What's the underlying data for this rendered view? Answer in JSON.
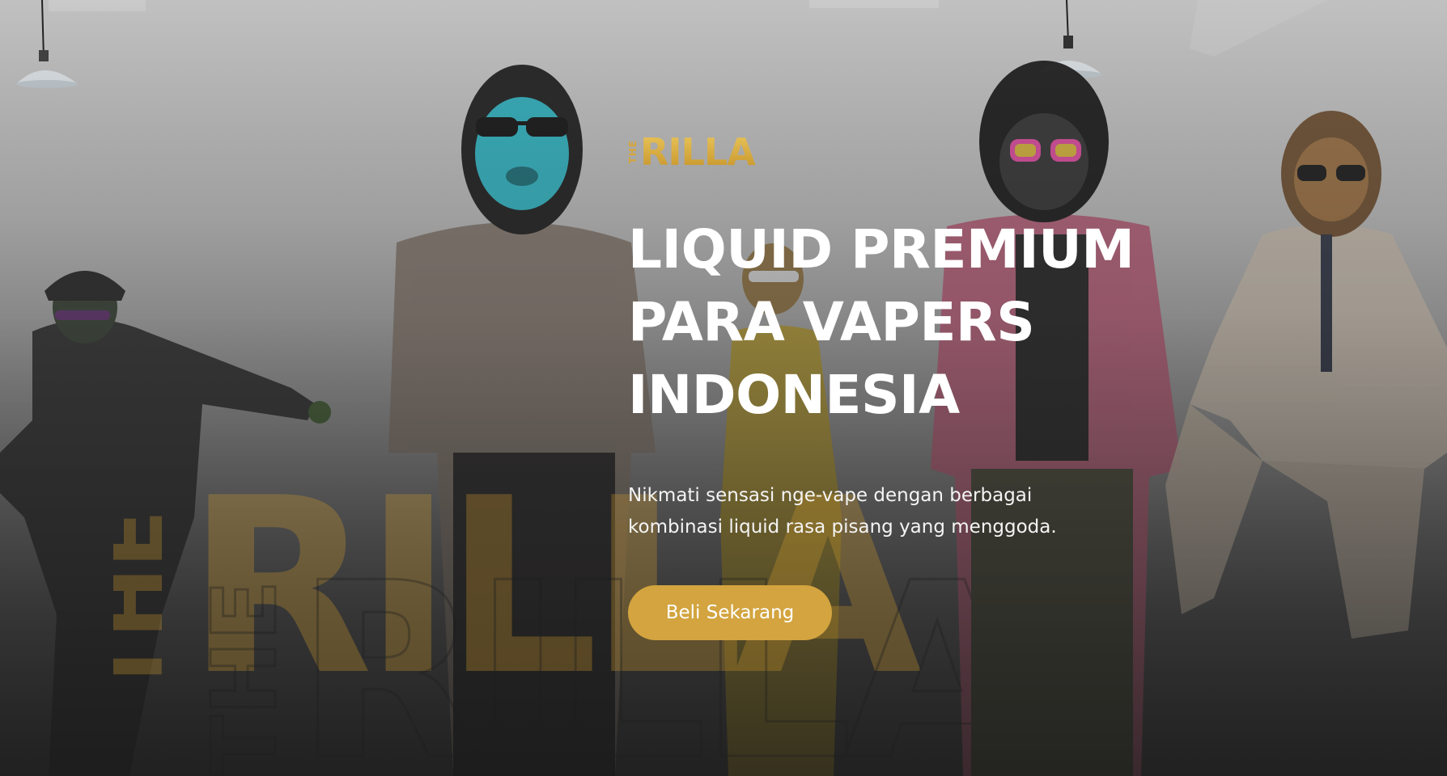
{
  "brand": {
    "logo_small": "THE",
    "logo_word": "RILLA"
  },
  "hero": {
    "headline_lines": [
      "LIQUID PREMIUM",
      "PARA VAPERS",
      "INDONESIA"
    ],
    "subtitle_lines": [
      "Nikmati sensasi nge-vape dengan berbagai",
      "kombinasi liquid rasa pisang yang menggoda."
    ],
    "cta_label": "Beli Sekarang"
  },
  "colors": {
    "accent": "#d3a43f",
    "headline": "#ffffff",
    "body_text": "#f4f4f4"
  },
  "icons": [
    "pendant-lamp-icon",
    "gorilla-mask-figure"
  ]
}
